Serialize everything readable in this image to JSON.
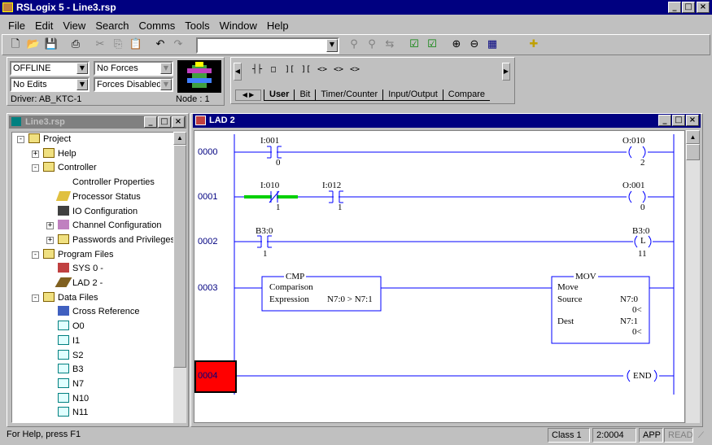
{
  "app": {
    "title": "RSLogix 5 - Line3.rsp"
  },
  "menu": [
    "File",
    "Edit",
    "View",
    "Search",
    "Comms",
    "Tools",
    "Window",
    "Help"
  ],
  "toolbar": {
    "icons": [
      "new-file-icon",
      "open-folder-icon",
      "save-icon",
      "print-icon",
      "cut-icon",
      "copy-icon",
      "paste-icon",
      "undo-icon",
      "redo-icon"
    ],
    "search_value": "",
    "right_icons": [
      "find-icon",
      "find-next-icon",
      "replace-icon",
      "verify-file-icon",
      "verify-routine-icon",
      "zoom-in-icon",
      "zoom-out-icon",
      "view-icon",
      "add-icon"
    ]
  },
  "status_panel": {
    "mode": "OFFLINE",
    "forces": "No Forces",
    "edits": "No Edits",
    "forces_state": "Forces Disabled",
    "driver": "Driver: AB_KTC-1",
    "node": "Node : 1"
  },
  "instr_tabs": [
    "User",
    "Bit",
    "Timer/Counter",
    "Input/Output",
    "Compare"
  ],
  "instr_symbols": [
    "┤├",
    "□",
    "][",
    "][",
    "<>",
    "<>",
    "<>"
  ],
  "project_window": {
    "title": "Line3.rsp",
    "tree": [
      {
        "label": "Project",
        "level": 0,
        "icon": "folder-open-icon",
        "pm": "-"
      },
      {
        "label": "Help",
        "level": 1,
        "icon": "folder-icon",
        "pm": "+"
      },
      {
        "label": "Controller",
        "level": 1,
        "icon": "folder-open-icon",
        "pm": "-"
      },
      {
        "label": "Controller Properties",
        "level": 2,
        "icon": "info-icon"
      },
      {
        "label": "Processor Status",
        "level": 2,
        "icon": "processor-status-icon"
      },
      {
        "label": "IO Configuration",
        "level": 2,
        "icon": "io-config-icon"
      },
      {
        "label": "Channel Configuration",
        "level": 2,
        "icon": "channel-config-icon",
        "pm": "+"
      },
      {
        "label": "Passwords and Privileges",
        "level": 2,
        "icon": "folder-icon",
        "pm": "+"
      },
      {
        "label": "Program Files",
        "level": 1,
        "icon": "folder-open-icon",
        "pm": "-"
      },
      {
        "label": "SYS 0 -",
        "level": 2,
        "icon": "sys-file-icon"
      },
      {
        "label": "LAD 2 -",
        "level": 2,
        "icon": "ladder-file-icon"
      },
      {
        "label": "Data Files",
        "level": 1,
        "icon": "folder-open-icon",
        "pm": "-"
      },
      {
        "label": "Cross Reference",
        "level": 2,
        "icon": "cross-reference-icon"
      },
      {
        "label": "O0",
        "level": 2,
        "icon": "data-file-icon"
      },
      {
        "label": "I1",
        "level": 2,
        "icon": "data-file-icon"
      },
      {
        "label": "S2",
        "level": 2,
        "icon": "data-file-icon"
      },
      {
        "label": "B3",
        "level": 2,
        "icon": "data-file-icon"
      },
      {
        "label": "N7",
        "level": 2,
        "icon": "data-file-icon"
      },
      {
        "label": "N10",
        "level": 2,
        "icon": "data-file-icon"
      },
      {
        "label": "N11",
        "level": 2,
        "icon": "data-file-icon"
      }
    ]
  },
  "ladder_window": {
    "title": "LAD 2",
    "rungs": [
      "0000",
      "0001",
      "0002",
      "0003",
      "0004"
    ],
    "r0": {
      "in_addr": "I:001",
      "in_bit": "0",
      "out_addr": "O:010",
      "out_bit": "2"
    },
    "r1": {
      "in1_addr": "I:010",
      "in1_bit": "1",
      "in2_addr": "I:012",
      "in2_bit": "1",
      "out_addr": "O:001",
      "out_bit": "0"
    },
    "r2": {
      "in_addr": "B3:0",
      "in_bit": "1",
      "out_addr": "B3:0",
      "out_sym": "L",
      "out_bit": "11"
    },
    "cmp": {
      "name": "CMP",
      "line1": "Comparison",
      "line2": "Expression",
      "expr": "N7:0 > N7:1"
    },
    "mov": {
      "name": "MOV",
      "line1": "Move",
      "source_label": "Source",
      "source": "N7:0",
      "source_val": "0<",
      "dest_label": "Dest",
      "dest": "N7:1",
      "dest_val": "0<"
    },
    "end": "END"
  },
  "statusbar": {
    "help": "For Help, press F1",
    "class": "Class 1",
    "pos": "2:0004",
    "mode": "APP",
    "read": "READ"
  }
}
